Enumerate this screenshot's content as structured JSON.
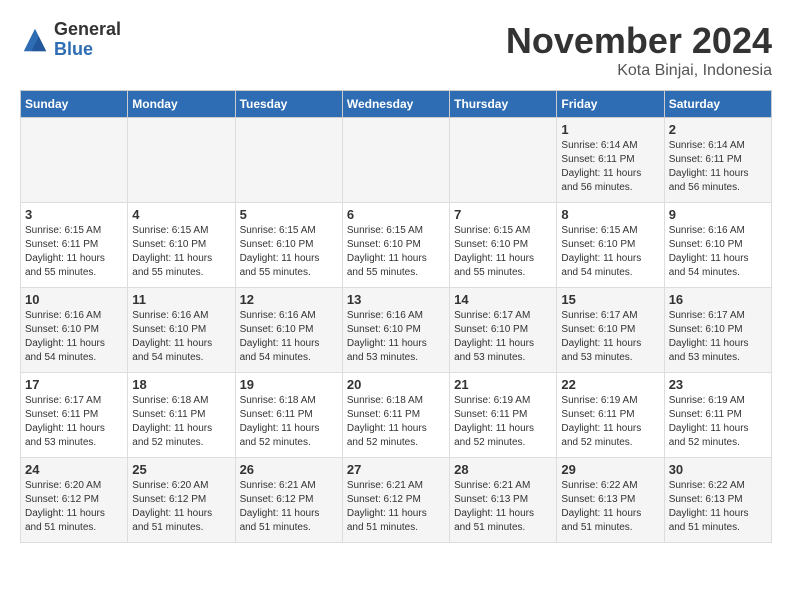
{
  "logo": {
    "general": "General",
    "blue": "Blue"
  },
  "title": "November 2024",
  "location": "Kota Binjai, Indonesia",
  "days_of_week": [
    "Sunday",
    "Monday",
    "Tuesday",
    "Wednesday",
    "Thursday",
    "Friday",
    "Saturday"
  ],
  "weeks": [
    [
      {
        "day": "",
        "info": ""
      },
      {
        "day": "",
        "info": ""
      },
      {
        "day": "",
        "info": ""
      },
      {
        "day": "",
        "info": ""
      },
      {
        "day": "",
        "info": ""
      },
      {
        "day": "1",
        "info": "Sunrise: 6:14 AM\nSunset: 6:11 PM\nDaylight: 11 hours and 56 minutes."
      },
      {
        "day": "2",
        "info": "Sunrise: 6:14 AM\nSunset: 6:11 PM\nDaylight: 11 hours and 56 minutes."
      }
    ],
    [
      {
        "day": "3",
        "info": "Sunrise: 6:15 AM\nSunset: 6:11 PM\nDaylight: 11 hours and 55 minutes."
      },
      {
        "day": "4",
        "info": "Sunrise: 6:15 AM\nSunset: 6:10 PM\nDaylight: 11 hours and 55 minutes."
      },
      {
        "day": "5",
        "info": "Sunrise: 6:15 AM\nSunset: 6:10 PM\nDaylight: 11 hours and 55 minutes."
      },
      {
        "day": "6",
        "info": "Sunrise: 6:15 AM\nSunset: 6:10 PM\nDaylight: 11 hours and 55 minutes."
      },
      {
        "day": "7",
        "info": "Sunrise: 6:15 AM\nSunset: 6:10 PM\nDaylight: 11 hours and 55 minutes."
      },
      {
        "day": "8",
        "info": "Sunrise: 6:15 AM\nSunset: 6:10 PM\nDaylight: 11 hours and 54 minutes."
      },
      {
        "day": "9",
        "info": "Sunrise: 6:16 AM\nSunset: 6:10 PM\nDaylight: 11 hours and 54 minutes."
      }
    ],
    [
      {
        "day": "10",
        "info": "Sunrise: 6:16 AM\nSunset: 6:10 PM\nDaylight: 11 hours and 54 minutes."
      },
      {
        "day": "11",
        "info": "Sunrise: 6:16 AM\nSunset: 6:10 PM\nDaylight: 11 hours and 54 minutes."
      },
      {
        "day": "12",
        "info": "Sunrise: 6:16 AM\nSunset: 6:10 PM\nDaylight: 11 hours and 54 minutes."
      },
      {
        "day": "13",
        "info": "Sunrise: 6:16 AM\nSunset: 6:10 PM\nDaylight: 11 hours and 53 minutes."
      },
      {
        "day": "14",
        "info": "Sunrise: 6:17 AM\nSunset: 6:10 PM\nDaylight: 11 hours and 53 minutes."
      },
      {
        "day": "15",
        "info": "Sunrise: 6:17 AM\nSunset: 6:10 PM\nDaylight: 11 hours and 53 minutes."
      },
      {
        "day": "16",
        "info": "Sunrise: 6:17 AM\nSunset: 6:10 PM\nDaylight: 11 hours and 53 minutes."
      }
    ],
    [
      {
        "day": "17",
        "info": "Sunrise: 6:17 AM\nSunset: 6:11 PM\nDaylight: 11 hours and 53 minutes."
      },
      {
        "day": "18",
        "info": "Sunrise: 6:18 AM\nSunset: 6:11 PM\nDaylight: 11 hours and 52 minutes."
      },
      {
        "day": "19",
        "info": "Sunrise: 6:18 AM\nSunset: 6:11 PM\nDaylight: 11 hours and 52 minutes."
      },
      {
        "day": "20",
        "info": "Sunrise: 6:18 AM\nSunset: 6:11 PM\nDaylight: 11 hours and 52 minutes."
      },
      {
        "day": "21",
        "info": "Sunrise: 6:19 AM\nSunset: 6:11 PM\nDaylight: 11 hours and 52 minutes."
      },
      {
        "day": "22",
        "info": "Sunrise: 6:19 AM\nSunset: 6:11 PM\nDaylight: 11 hours and 52 minutes."
      },
      {
        "day": "23",
        "info": "Sunrise: 6:19 AM\nSunset: 6:11 PM\nDaylight: 11 hours and 52 minutes."
      }
    ],
    [
      {
        "day": "24",
        "info": "Sunrise: 6:20 AM\nSunset: 6:12 PM\nDaylight: 11 hours and 51 minutes."
      },
      {
        "day": "25",
        "info": "Sunrise: 6:20 AM\nSunset: 6:12 PM\nDaylight: 11 hours and 51 minutes."
      },
      {
        "day": "26",
        "info": "Sunrise: 6:21 AM\nSunset: 6:12 PM\nDaylight: 11 hours and 51 minutes."
      },
      {
        "day": "27",
        "info": "Sunrise: 6:21 AM\nSunset: 6:12 PM\nDaylight: 11 hours and 51 minutes."
      },
      {
        "day": "28",
        "info": "Sunrise: 6:21 AM\nSunset: 6:13 PM\nDaylight: 11 hours and 51 minutes."
      },
      {
        "day": "29",
        "info": "Sunrise: 6:22 AM\nSunset: 6:13 PM\nDaylight: 11 hours and 51 minutes."
      },
      {
        "day": "30",
        "info": "Sunrise: 6:22 AM\nSunset: 6:13 PM\nDaylight: 11 hours and 51 minutes."
      }
    ]
  ]
}
